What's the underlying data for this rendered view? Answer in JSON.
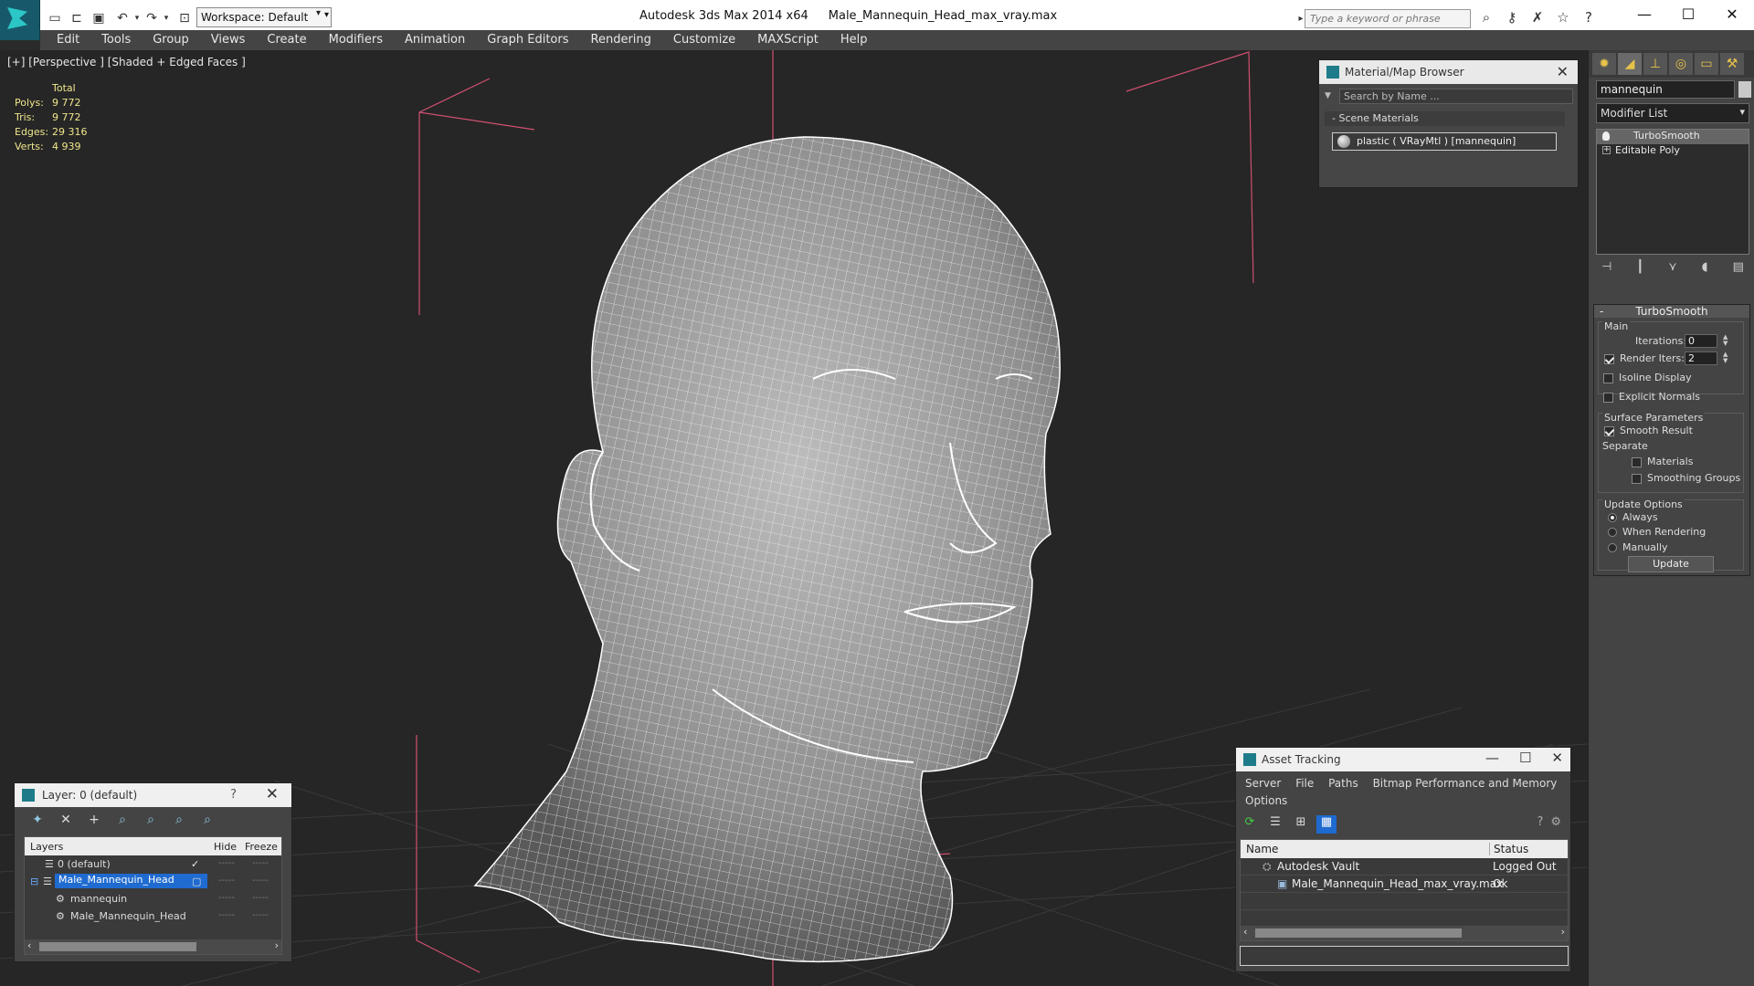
{
  "title_bar": {
    "app_title": "Autodesk 3ds Max  2014 x64",
    "file_name": "Male_Mannequin_Head_max_vray.max",
    "workspace": "Workspace: Default",
    "search_placeholder": "Type a keyword or phrase"
  },
  "menu": [
    "Edit",
    "Tools",
    "Group",
    "Views",
    "Create",
    "Modifiers",
    "Animation",
    "Graph Editors",
    "Rendering",
    "Customize",
    "MAXScript",
    "Help"
  ],
  "viewport": {
    "label": "[+] [Perspective ] [Shaded + Edged Faces ]",
    "stats_header": "Total",
    "stats": [
      {
        "k": "Polys:",
        "v": "9 772"
      },
      {
        "k": "Tris:",
        "v": "9 772"
      },
      {
        "k": "Edges:",
        "v": "29 316"
      },
      {
        "k": "Verts:",
        "v": "4 939"
      }
    ]
  },
  "material_browser": {
    "title": "Material/Map Browser",
    "search_placeholder": "Search by Name ...",
    "group": "- Scene Materials",
    "item": "plastic  ( VRayMtl )  [mannequin]"
  },
  "command_panel": {
    "object_name": "mannequin",
    "modifier_list": "Modifier List",
    "stack": [
      "TurboSmooth",
      "Editable Poly"
    ],
    "rollout_title": "TurboSmooth",
    "main_label": "Main",
    "iterations_label": "Iterations:",
    "iterations_value": "0",
    "render_iters_label": "Render Iters:",
    "render_iters_value": "2",
    "isoline_label": "Isoline Display",
    "explicit_normals_label": "Explicit Normals",
    "surface_params_label": "Surface Parameters",
    "smooth_result_label": "Smooth Result",
    "separate_label": "Separate",
    "materials_label": "Materials",
    "smoothing_groups_label": "Smoothing Groups",
    "update_options_label": "Update Options",
    "always_label": "Always",
    "when_rendering_label": "When Rendering",
    "manually_label": "Manually",
    "update_button": "Update"
  },
  "layer_panel": {
    "title": "Layer: 0 (default)",
    "help": "?",
    "col_layers": "Layers",
    "col_hide": "Hide",
    "col_freeze": "Freeze",
    "rows": [
      {
        "name": "0 (default)"
      },
      {
        "name": "Male_Mannequin_Head"
      },
      {
        "name": "mannequin"
      },
      {
        "name": "Male_Mannequin_Head"
      }
    ],
    "dash": "-----"
  },
  "asset_tracking": {
    "title": "Asset Tracking",
    "menu": [
      "Server",
      "File",
      "Paths",
      "Bitmap Performance and Memory"
    ],
    "menu2": "Options",
    "col_name": "Name",
    "col_status": "Status",
    "rows": [
      {
        "name": "Autodesk Vault",
        "status": "Logged Out ..."
      },
      {
        "name": "Male_Mannequin_Head_max_vray.max",
        "status": "Ok"
      }
    ]
  }
}
